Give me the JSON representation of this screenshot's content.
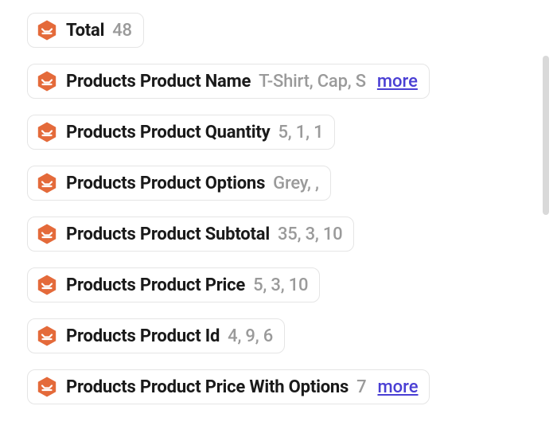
{
  "more_label": "more",
  "items": [
    {
      "label": "Total",
      "value": "48",
      "more": false
    },
    {
      "label": "Products Product Name",
      "value": "T-Shirt, Cap, S",
      "more": true
    },
    {
      "label": "Products Product Quantity",
      "value": "5, 1, 1",
      "more": false
    },
    {
      "label": "Products Product Options",
      "value": "Grey, ,",
      "more": false
    },
    {
      "label": "Products Product Subtotal",
      "value": "35, 3, 10",
      "more": false
    },
    {
      "label": "Products Product Price",
      "value": "5, 3, 10",
      "more": false
    },
    {
      "label": "Products Product Id",
      "value": "4, 9, 6",
      "more": false
    },
    {
      "label": "Products Product Price With Options",
      "value": "7",
      "more": true
    }
  ]
}
